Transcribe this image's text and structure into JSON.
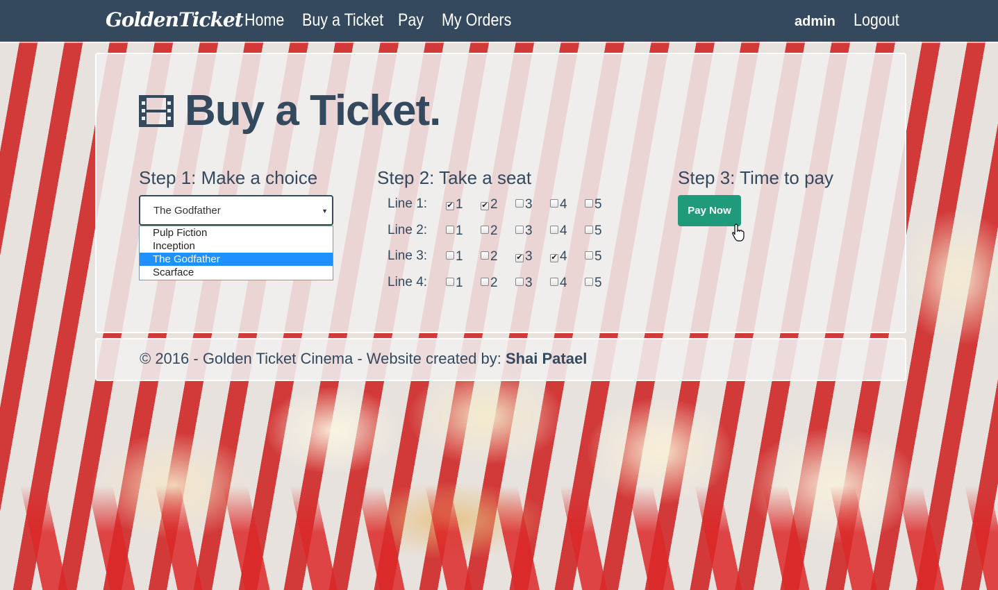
{
  "navbar": {
    "brand": "GoldenTicket",
    "links": [
      "Home",
      "Buy a Ticket",
      "Pay",
      "My Orders"
    ],
    "user": "admin",
    "logout": "Logout"
  },
  "page": {
    "title": "Buy a Ticket.",
    "icon": "film-icon"
  },
  "step1": {
    "title": "Step 1: Make a choice",
    "selected": "The Godfather",
    "options": [
      "Pulp Fiction",
      "Inception",
      "The Godfather",
      "Scarface"
    ]
  },
  "step2": {
    "title": "Step 2: Take a seat",
    "lines": [
      {
        "label": "Line 1:",
        "seats": [
          "1",
          "2",
          "3",
          "4",
          "5"
        ],
        "checked": [
          true,
          true,
          false,
          false,
          false
        ]
      },
      {
        "label": "Line 2:",
        "seats": [
          "1",
          "2",
          "3",
          "4",
          "5"
        ],
        "checked": [
          false,
          false,
          false,
          false,
          false
        ]
      },
      {
        "label": "Line 3:",
        "seats": [
          "1",
          "2",
          "3",
          "4",
          "5"
        ],
        "checked": [
          false,
          false,
          true,
          true,
          false
        ]
      },
      {
        "label": "Line 4:",
        "seats": [
          "1",
          "2",
          "3",
          "4",
          "5"
        ],
        "checked": [
          false,
          false,
          false,
          false,
          false
        ]
      }
    ]
  },
  "step3": {
    "title": "Step 3: Time to pay",
    "button": "Pay Now"
  },
  "footer": {
    "text": "© 2016 - Golden Ticket Cinema - Website created by: ",
    "author": "Shai Patael"
  },
  "colors": {
    "navbar": "#34495e",
    "primary_text": "#34495e",
    "pay_button": "#1f9a7a",
    "selected_option": "#1e90ff"
  }
}
